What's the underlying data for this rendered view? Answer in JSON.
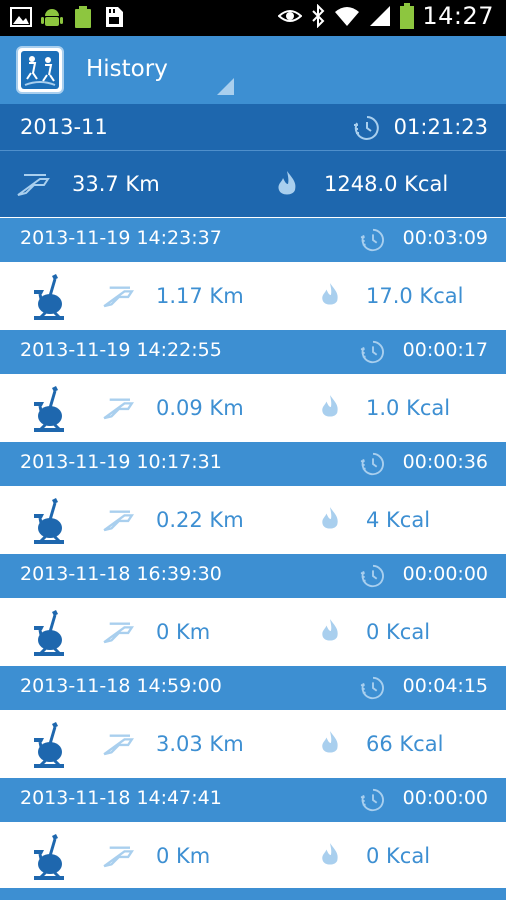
{
  "status_bar": {
    "time": "14:27",
    "icons": [
      "image-icon",
      "android-icon",
      "battery-small-icon",
      "sd-card-icon",
      "eye-icon",
      "bluetooth-icon",
      "wifi-icon",
      "signal-icon",
      "battery-icon"
    ]
  },
  "action_bar": {
    "title": "History",
    "app_icon": "app-logo-icon"
  },
  "summary": {
    "month": "2013-11",
    "total_duration": "01:21:23",
    "total_distance": "33.7 Km",
    "total_calories": "1248.0 Kcal"
  },
  "records": [
    {
      "datetime": "2013-11-19 14:23:37",
      "duration": "00:03:09",
      "distance": "1.17 Km",
      "calories": "17.0 Kcal"
    },
    {
      "datetime": "2013-11-19 14:22:55",
      "duration": "00:00:17",
      "distance": "0.09 Km",
      "calories": "1.0 Kcal"
    },
    {
      "datetime": "2013-11-19 10:17:31",
      "duration": "00:00:36",
      "distance": "0.22 Km",
      "calories": "4 Kcal"
    },
    {
      "datetime": "2013-11-18 16:39:30",
      "duration": "00:00:00",
      "distance": "0 Km",
      "calories": "0 Kcal"
    },
    {
      "datetime": "2013-11-18 14:59:00",
      "duration": "00:04:15",
      "distance": "3.03 Km",
      "calories": "66 Kcal"
    },
    {
      "datetime": "2013-11-18 14:47:41",
      "duration": "00:00:00",
      "distance": "0 Km",
      "calories": "0 Kcal"
    }
  ],
  "colors": {
    "action_bar": "#3d8fd2",
    "summary_bg": "#1e67ae",
    "record_header_bg": "#3d8fd2",
    "record_text": "#3d8fd2",
    "icon_light": "#a9cfee"
  }
}
